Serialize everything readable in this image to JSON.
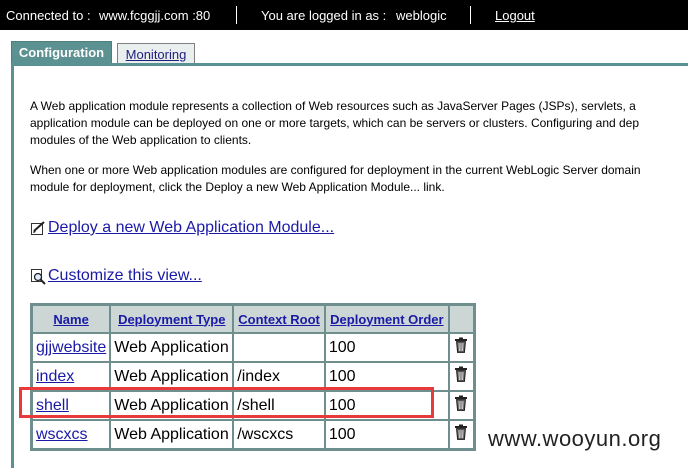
{
  "topbar": {
    "connected_label": "Connected to :",
    "connected_host": "www.fcggjj.com :80",
    "logged_in_label": "You are logged in as :",
    "username": "weblogic",
    "logout_label": "Logout"
  },
  "tabs": [
    {
      "label": "Configuration",
      "active": true
    },
    {
      "label": "Monitoring",
      "active": false
    }
  ],
  "description": {
    "p1_line1": "A Web application module represents a collection of Web resources such as JavaServer Pages (JSPs), servlets, a",
    "p1_line2": "application module can be deployed on one or more targets, which can be servers or clusters. Configuring and dep",
    "p1_line3": "modules of the Web application to clients.",
    "p2_line1": "When one or more Web application modules are configured for deployment in the current WebLogic Server domain",
    "p2_line2": "module for deployment, click the Deploy a new Web Application Module... link."
  },
  "actions": {
    "deploy_label": "Deploy a new Web Application Module...",
    "customize_label": "Customize this view..."
  },
  "table": {
    "headers": [
      "Name",
      "Deployment Type",
      "Context Root",
      "Deployment Order"
    ],
    "rows": [
      {
        "name": "gjjwebsite",
        "type": "Web Application",
        "context_root": "",
        "order": "100"
      },
      {
        "name": "index",
        "type": "Web Application",
        "context_root": "/index",
        "order": "100"
      },
      {
        "name": "shell",
        "type": "Web Application",
        "context_root": "/shell",
        "order": "100"
      },
      {
        "name": "wscxcs",
        "type": "Web Application",
        "context_root": "/wscxcs",
        "order": "100"
      }
    ],
    "row_icon": "trash-icon",
    "highlighted_row": "shell"
  },
  "watermark": "www.wooyun.org",
  "colors": {
    "topbar": "#000000",
    "tab_active": "#5b9190",
    "header_bg": "#cbd6d5",
    "link": "#1a1aa6",
    "highlight": "#e83a3a"
  }
}
